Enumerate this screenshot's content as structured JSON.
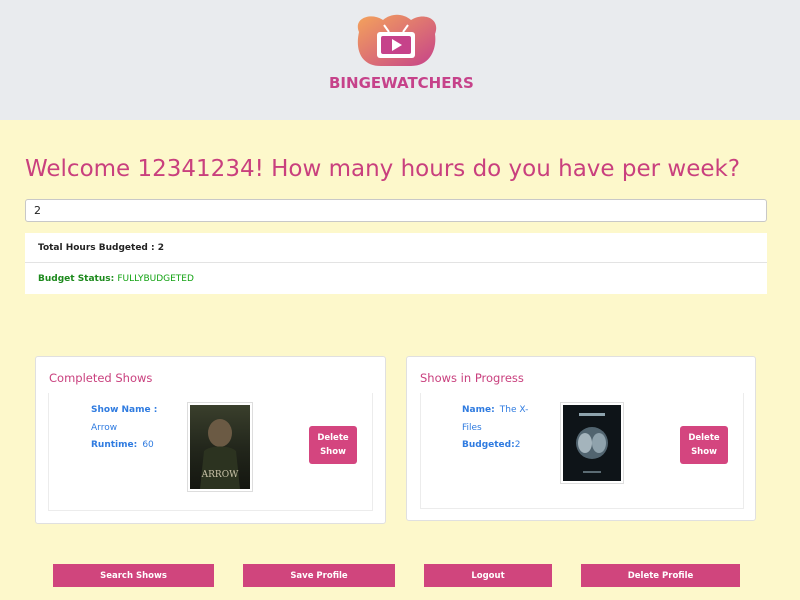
{
  "brand": {
    "name": "BINGEWATCHERS"
  },
  "welcome": {
    "text": "Welcome 12341234! How many hours do you have per week?"
  },
  "hours_input": {
    "value": "2"
  },
  "budget": {
    "total_label": "Total Hours Budgeted : 2",
    "status_label": "Budget Status:",
    "status_value": "FULLYBUDGETED"
  },
  "completed": {
    "title": "Completed Shows",
    "show": {
      "name_label": "Show Name :",
      "name_value": "Arrow",
      "runtime_label": "Runtime:",
      "runtime_value": "60",
      "poster_caption": "ARROW",
      "delete_label_1": "Delete",
      "delete_label_2": "Show"
    }
  },
  "in_progress": {
    "title": "Shows in Progress",
    "show": {
      "name_label": "Name:",
      "name_value_1": "The X-",
      "name_value_2": "Files",
      "budgeted_label": "Budgeted:",
      "budgeted_value": "2",
      "delete_label_1": "Delete",
      "delete_label_2": "Show"
    }
  },
  "actions": {
    "search": "Search Shows",
    "save": "Save Profile",
    "logout": "Logout",
    "delete_profile": "Delete Profile"
  },
  "colors": {
    "accent": "#d0457d",
    "title_pink": "#c9407e",
    "link_blue": "#2f7be0",
    "status_green": "#14a314",
    "page_bg": "#fdf8cb"
  }
}
